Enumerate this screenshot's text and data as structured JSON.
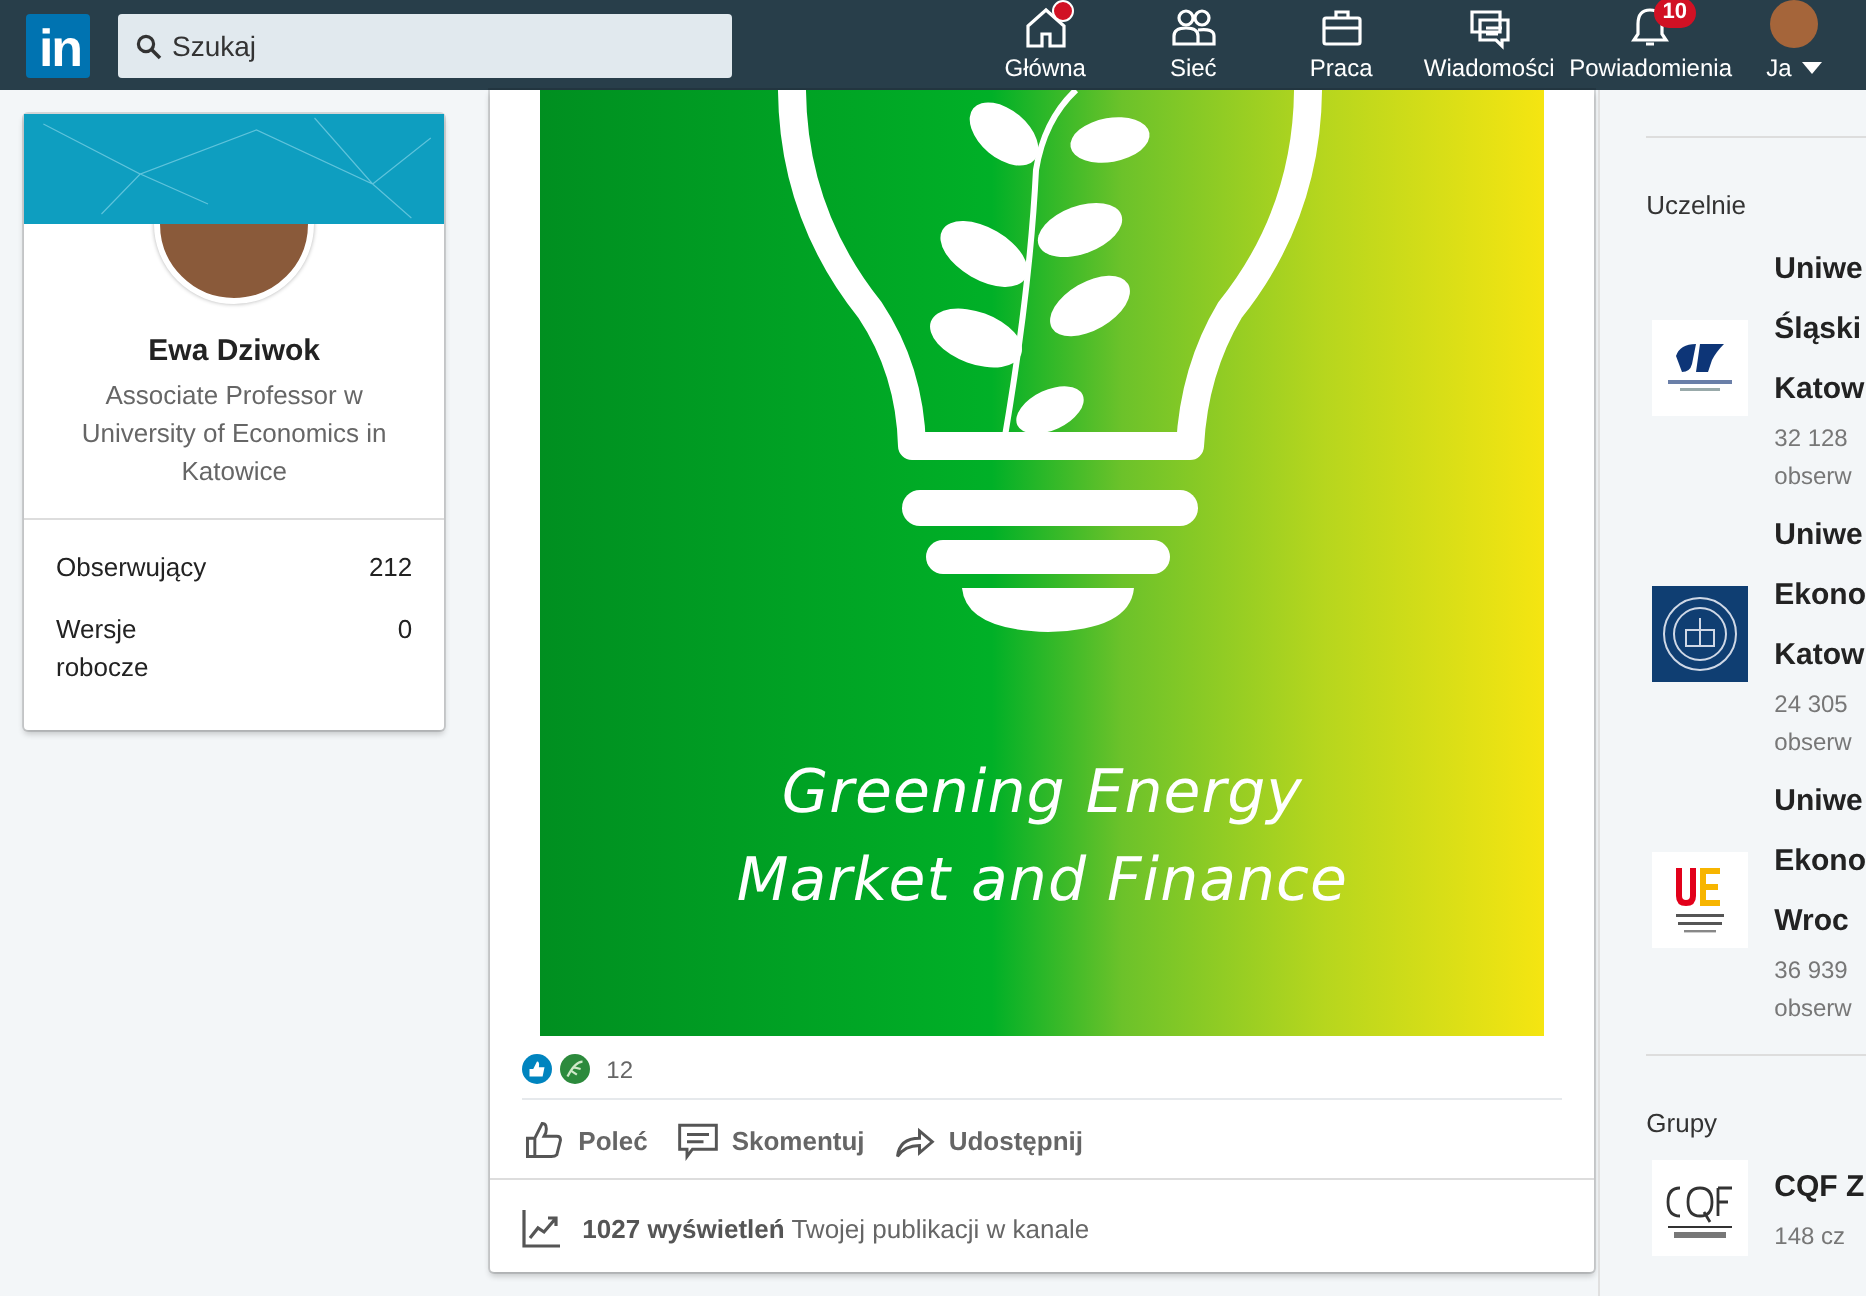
{
  "header": {
    "logo": "in",
    "search": {
      "placeholder": "Szukaj"
    },
    "nav": [
      {
        "label": "Główna",
        "dot": true
      },
      {
        "label": "Sieć",
        "dot": false
      },
      {
        "label": "Praca",
        "dot": false
      },
      {
        "label": "Wiadomości",
        "dot": false
      },
      {
        "label": "Powiadomienia",
        "dot": false,
        "badge": "10"
      },
      {
        "label": "Ja",
        "dot": false
      }
    ]
  },
  "profile": {
    "name": "Ewa Dziwok",
    "headline": "Associate Professor w University of Economics in Katowice",
    "stats": [
      {
        "label": "Obserwujący",
        "value": "212"
      },
      {
        "label": "Wersje robocze",
        "value": "0"
      }
    ]
  },
  "post": {
    "cover_title_lines": [
      "Greening Energy",
      "Market and Finance"
    ],
    "reaction_count": "12",
    "actions": [
      {
        "label": "Poleć"
      },
      {
        "label": "Skomentuj"
      },
      {
        "label": "Udostępnij"
      }
    ],
    "views": "**1027 wyświetleń** Twojej publikacji w kanale"
  },
  "sidebar": {
    "sections": [
      {
        "title": "Uczelnie",
        "items": [
          {
            "name_lines": [
              "Uniwe",
              "Śląski",
              "Katow"
            ],
            "meta_lines": [
              "32 128",
              "obserw"
            ]
          },
          {
            "name_lines": [
              "Uniwe",
              "Ekono",
              "Katow"
            ],
            "meta_lines": [
              "24 305",
              "obserw"
            ]
          },
          {
            "name_lines": [
              "Uniwe",
              "Ekono",
              "Wroc"
            ],
            "meta_lines": [
              "36 939",
              "obserw"
            ]
          }
        ]
      },
      {
        "title": "Grupy",
        "items": [
          {
            "name_lines": [
              "CQF Z"
            ],
            "meta_lines": [
              "148 cz"
            ]
          }
        ]
      }
    ]
  }
}
